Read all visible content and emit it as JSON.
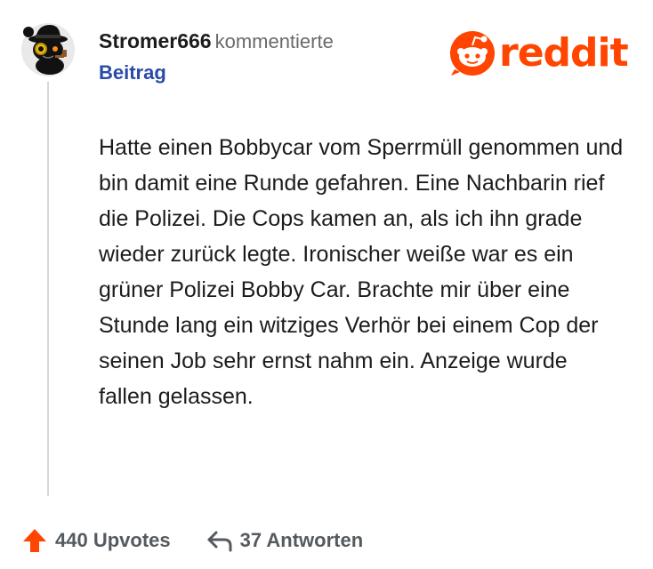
{
  "comment": {
    "username": "Stromer666",
    "action": "kommentierte",
    "post_label": "Beitrag",
    "avatar_icon": "snoo-detective-avatar-icon",
    "body": "Hatte einen Bobbycar vom Sperrmüll genommen und bin damit eine Runde gefahren. Eine Nachbarin rief die Polizei. Die Cops kamen an, als ich ihn grade wieder zurück legte. Ironischer weiße war es ein grüner Polizei Bobby Car. Brachte mir über eine Stunde lang ein witziges Verhör bei einem Cop der seinen Job sehr ernst nahm ein. Anzeige wurde fallen gelassen."
  },
  "brand": {
    "logo_text": "reddit",
    "logo_icon": "reddit-snoo-icon",
    "color": "#ff4500"
  },
  "footer": {
    "upvote_icon": "upvote-arrow-icon",
    "upvotes": "440 Upvotes",
    "reply_icon": "reply-arrow-icon",
    "replies": "37 Antworten"
  }
}
